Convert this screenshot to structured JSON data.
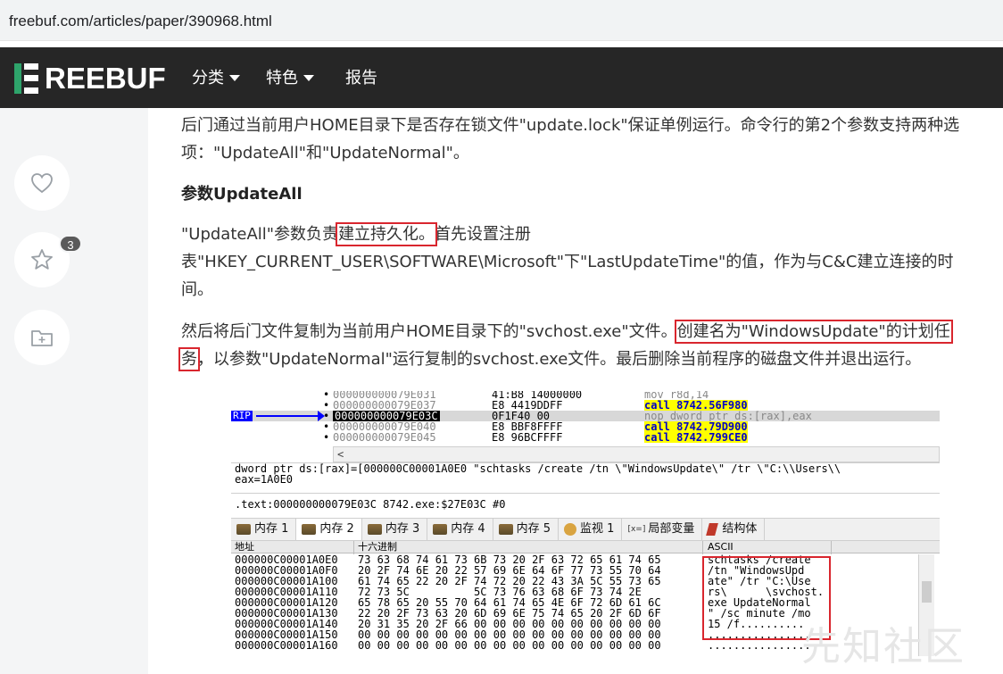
{
  "browser": {
    "url": "freebuf.com/articles/paper/390968.html"
  },
  "nav": {
    "logo_text": "REEBUF",
    "items": [
      {
        "label": "分类",
        "has_caret": true
      },
      {
        "label": "特色",
        "has_caret": true
      },
      {
        "label": "报告",
        "has_caret": false
      }
    ]
  },
  "actions": {
    "favorite_count": "3"
  },
  "article": {
    "p1_line1": "后门通过当前用户HOME目录下是否存在锁文件\"update.lock\"保证单例运行。命令行的第2个参数支持两种选",
    "p1_line2": "项：\"UpdateAll\"和\"UpdateNormal\"。",
    "heading": "参数UpdateAll",
    "p2_a": "\"UpdateAll\"参数负责",
    "p2_hl": "建立持久化。",
    "p2_b": "首先设置注册",
    "p2_line2": "表\"HKEY_CURRENT_USER\\SOFTWARE\\Microsoft\"下\"LastUpdateTime\"的值，作为与C&C建立连接的时",
    "p2_line3": "间。",
    "p3_a": "然后将后门文件复制为当前用户HOME目录下的\"svchost.exe\"文件。",
    "p3_hl1": "创建名为\"WindowsUpdate\"的计划任",
    "p3_hl2": "务",
    "p3_b": "，以参数\"UpdateNormal\"运行复制的svchost.exe文件。最后删除当前程序的磁盘文件并退出运行。"
  },
  "debugger": {
    "rip_label": "RIP",
    "disasm_rows": [
      {
        "addr": "000000000079E031",
        "bytes": "41:B8 14000000",
        "ins": "mov r8d,14",
        "call": false
      },
      {
        "addr": "000000000079E037",
        "bytes": "E8 4419DDFF",
        "ins": "call 8742.56F980",
        "call": true
      },
      {
        "addr": "000000000079E03C",
        "bytes": "0F1F40 00",
        "ins": "nop dword ptr ds:[rax],eax",
        "call": false
      },
      {
        "addr": "000000000079E040",
        "bytes": "E8 BBF8FFFF",
        "ins": "call 8742.79D900",
        "call": true
      },
      {
        "addr": "000000000079E045",
        "bytes": "E8 96BCFFFF",
        "ins": "call 8742.799CE0",
        "call": true
      }
    ],
    "scroll_glyph": "<",
    "info_line1": "dword ptr ds:[rax]=[000000C00001A0E0 \"schtasks /create /tn \\\"WindowsUpdate\\\" /tr \\\"C:\\\\Users\\\\",
    "info_line2": "eax=1A0E0",
    "info_line3": ".text:000000000079E03C 8742.exe:$27E03C #0",
    "tabs": [
      {
        "label": "内存 1",
        "active": false
      },
      {
        "label": "内存 2",
        "active": true
      },
      {
        "label": "内存 3",
        "active": false
      },
      {
        "label": "内存 4",
        "active": false
      },
      {
        "label": "内存 5",
        "active": false
      },
      {
        "label": "监视 1",
        "active": false
      },
      {
        "label": "局部变量",
        "active": false
      },
      {
        "label": "结构体",
        "active": false
      }
    ],
    "locals_prefix": "[x=]",
    "hex_headers": {
      "addr": "地址",
      "hex": "十六进制",
      "ascii": "ASCII"
    },
    "hex_rows": [
      {
        "addr": "000000C00001A0E0",
        "hex": "73 63 68 74 61 73 6B 73 20 2F 63 72 65 61 74 65",
        "ascii": "schtasks /create"
      },
      {
        "addr": "000000C00001A0F0",
        "hex": "20 2F 74 6E 20 22 57 69 6E 64 6F 77 73 55 70 64",
        "ascii": " /tn \"WindowsUpd"
      },
      {
        "addr": "000000C00001A100",
        "hex": "61 74 65 22 20 2F 74 72 20 22 43 3A 5C 55 73 65",
        "ascii": "ate\" /tr \"C:\\Use"
      },
      {
        "addr": "000000C00001A110",
        "hex": "72 73 5C          5C 73 76 63 68 6F 73 74 2E",
        "ascii": "rs\\      \\svchost."
      },
      {
        "addr": "000000C00001A120",
        "hex": "65 78 65 20 55 70 64 61 74 65 4E 6F 72 6D 61 6C",
        "ascii": "exe UpdateNormal"
      },
      {
        "addr": "000000C00001A130",
        "hex": "22 20 2F 73 63 20 6D 69 6E 75 74 65 20 2F 6D 6F",
        "ascii": "\" /sc minute /mo"
      },
      {
        "addr": "000000C00001A140",
        "hex": "20 31 35 20 2F 66 00 00 00 00 00 00 00 00 00 00",
        "ascii": " 15 /f.........."
      },
      {
        "addr": "000000C00001A150",
        "hex": "00 00 00 00 00 00 00 00 00 00 00 00 00 00 00 00",
        "ascii": "................"
      },
      {
        "addr": "000000C00001A160",
        "hex": "00 00 00 00 00 00 00 00 00 00 00 00 00 00 00 00",
        "ascii": "................"
      }
    ]
  },
  "watermark": "先知社区",
  "colors": {
    "brand_green": "#2ea46b",
    "highlight_red": "#d9262e",
    "nav_bg": "#262626"
  }
}
